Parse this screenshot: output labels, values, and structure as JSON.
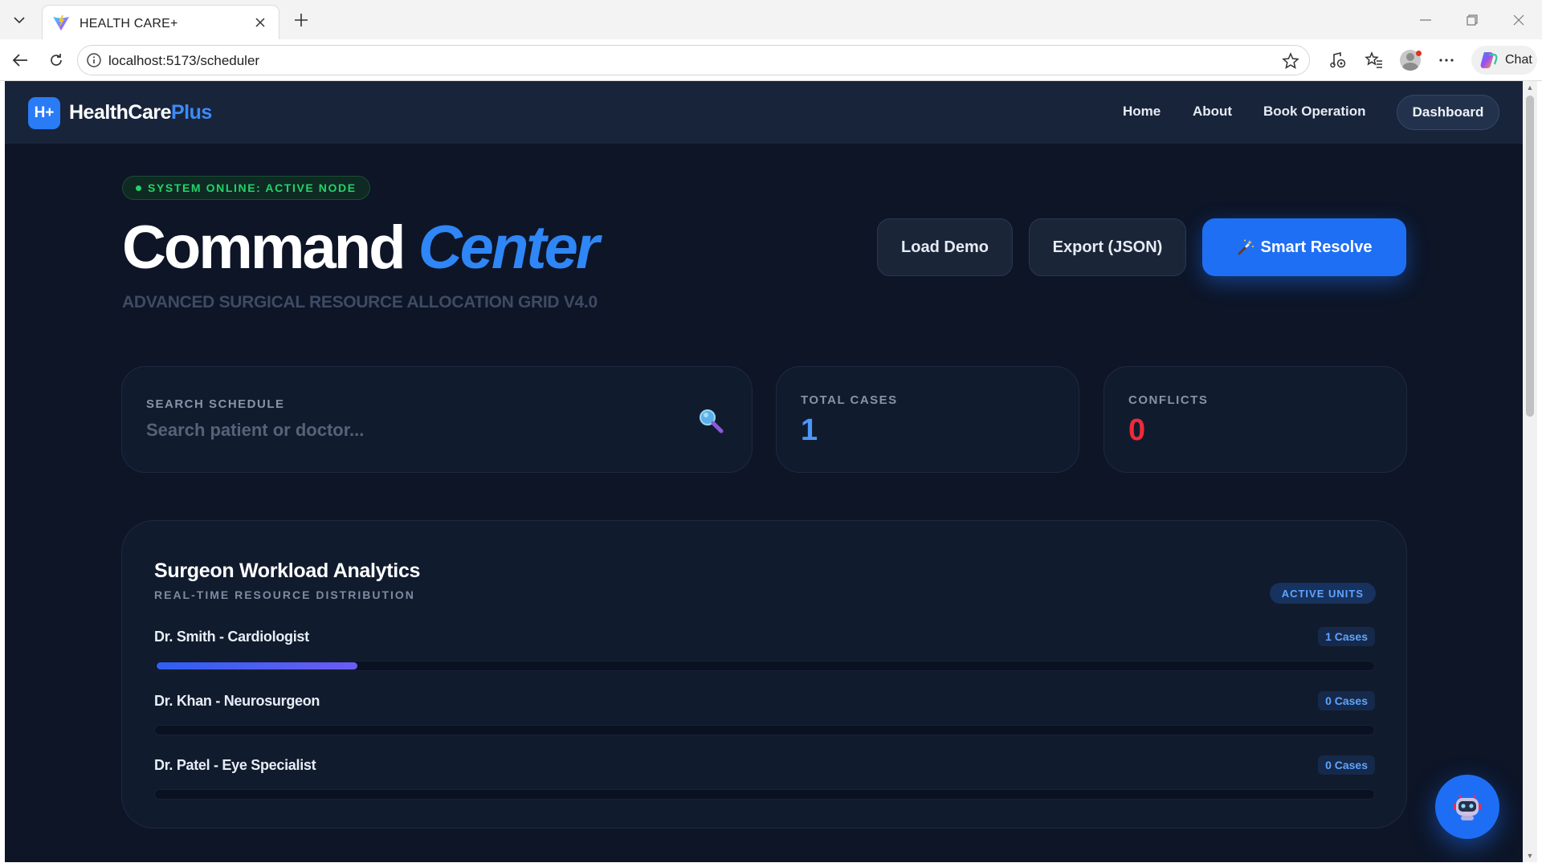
{
  "browser": {
    "tab_title": "HEALTH CARE+",
    "url": "localhost:5173/scheduler",
    "chat_label": "Chat"
  },
  "nav": {
    "logo_badge": "H+",
    "logo_main": "HealthCare",
    "logo_accent": "Plus",
    "links": [
      "Home",
      "About",
      "Book Operation"
    ],
    "dashboard": "Dashboard"
  },
  "hero": {
    "status": "SYSTEM ONLINE: ACTIVE NODE",
    "title_main": "Command",
    "title_accent": "Center",
    "subtitle": "ADVANCED SURGICAL RESOURCE ALLOCATION GRID V4.0",
    "buttons": {
      "load_demo": "Load Demo",
      "export": "Export (JSON)",
      "smart_resolve": "Smart Resolve"
    }
  },
  "search": {
    "label": "SEARCH SCHEDULE",
    "placeholder": "Search patient or doctor..."
  },
  "stats": {
    "total_label": "TOTAL CASES",
    "total_value": "1",
    "conflicts_label": "CONFLICTS",
    "conflicts_value": "0"
  },
  "analytics": {
    "title": "Surgeon Workload Analytics",
    "subtitle": "REAL-TIME RESOURCE DISTRIBUTION",
    "badge": "ACTIVE UNITS",
    "surgeons": [
      {
        "name": "Dr. Smith - Cardiologist",
        "cases": "1 Cases",
        "load": 0.165
      },
      {
        "name": "Dr. Khan - Neurosurgeon",
        "cases": "0 Cases",
        "load": 0
      },
      {
        "name": "Dr. Patel - Eye Specialist",
        "cases": "0 Cases",
        "load": 0
      }
    ]
  },
  "colors": {
    "page_bg": "#0d1527",
    "accent_blue": "#2f86f6",
    "success_green": "#22d36b",
    "conflict_red": "#ef2a3a"
  }
}
